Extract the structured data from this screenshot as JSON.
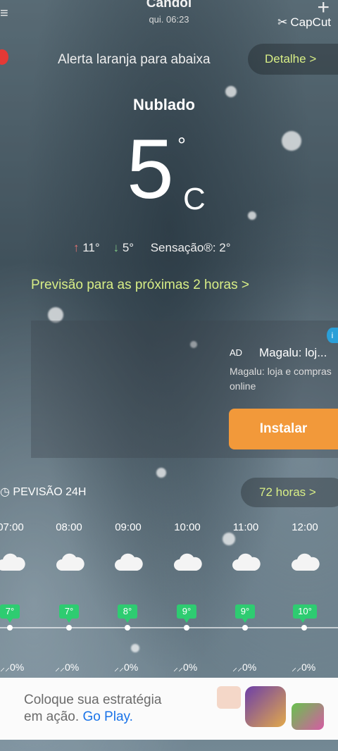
{
  "header": {
    "city": "Candói",
    "time": "qui. 06:23",
    "watermark": "CapCut"
  },
  "alert": {
    "text": "Alerta laranja para abaixa",
    "button": "Detalhe >"
  },
  "current": {
    "condition": "Nublado",
    "temp": "5",
    "deg": "°",
    "unit": "C",
    "high": "11°",
    "low": "5°",
    "feels": "Sensação®: 2°"
  },
  "forecast_link": "Previsão para as próximas 2 horas >",
  "ad": {
    "tag": "AD",
    "title": "Magalu: loj...",
    "desc": "Magalu: loja e compras online",
    "install": "Instalar",
    "info": "i"
  },
  "hourly": {
    "title": "PEVISÃO 24H",
    "more": "72 horas >",
    "hours": [
      {
        "time": "07:00",
        "temp": "7°",
        "rain": "0%"
      },
      {
        "time": "08:00",
        "temp": "7°",
        "rain": "0%"
      },
      {
        "time": "09:00",
        "temp": "8°",
        "rain": "0%"
      },
      {
        "time": "10:00",
        "temp": "9°",
        "rain": "0%"
      },
      {
        "time": "11:00",
        "temp": "9°",
        "rain": "0%"
      },
      {
        "time": "12:00",
        "temp": "10°",
        "rain": "0%"
      }
    ]
  },
  "bottom_ad": {
    "line1": "Coloque sua estratégia",
    "line2a": "em ação.",
    "line2b": "Go Play."
  },
  "colors": {
    "accent": "#d8ee86",
    "install": "#f2993a",
    "temp_badge": "#2ecc71"
  }
}
